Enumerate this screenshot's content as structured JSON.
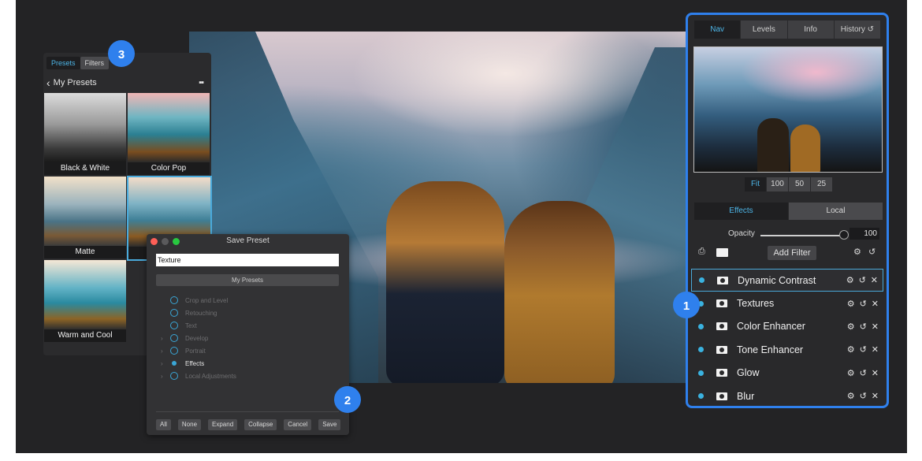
{
  "presets_panel": {
    "tabs": [
      "Presets",
      "Filters"
    ],
    "header": "My Presets",
    "thumbnails": [
      {
        "caption": "Black & White",
        "selected": false
      },
      {
        "caption": "Color Pop",
        "selected": false
      },
      {
        "caption": "Matte",
        "selected": false
      },
      {
        "caption": "",
        "selected": true
      },
      {
        "caption": "Warm and Cool",
        "selected": false
      }
    ]
  },
  "save_dialog": {
    "title": "Save Preset",
    "name_value": "Texture",
    "folder": "My Presets",
    "categories": [
      {
        "label": "Crop and Level",
        "expandable": false,
        "selected": false
      },
      {
        "label": "Retouching",
        "expandable": false,
        "selected": false
      },
      {
        "label": "Text",
        "expandable": false,
        "selected": false
      },
      {
        "label": "Develop",
        "expandable": true,
        "selected": false
      },
      {
        "label": "Portrait",
        "expandable": true,
        "selected": false
      },
      {
        "label": "Effects",
        "expandable": true,
        "selected": true
      },
      {
        "label": "Local Adjustments",
        "expandable": true,
        "selected": false
      }
    ],
    "buttons": [
      "All",
      "None",
      "Expand",
      "Collapse",
      "Cancel",
      "Save"
    ]
  },
  "right_panel": {
    "tabs": [
      "Nav",
      "Levels",
      "Info",
      "History"
    ],
    "active_tab": "Nav",
    "zoom_options": [
      "Fit",
      "100",
      "50",
      "25"
    ],
    "active_zoom": "Fit",
    "mode_tabs": [
      "Effects",
      "Local"
    ],
    "active_mode": "Effects",
    "opacity_label": "Opacity",
    "opacity_value": "100",
    "add_filter_label": "Add Filter",
    "filters": [
      {
        "name": "Dynamic Contrast",
        "selected": true
      },
      {
        "name": "Textures",
        "selected": false
      },
      {
        "name": "Color Enhancer",
        "selected": false
      },
      {
        "name": "Tone Enhancer",
        "selected": false
      },
      {
        "name": "Glow",
        "selected": false
      },
      {
        "name": "Blur",
        "selected": false
      }
    ]
  },
  "badges": [
    "1",
    "2",
    "3"
  ],
  "colors": {
    "accent_blue": "#2f80ed",
    "active_tab_text": "#4db6e8",
    "filter_dot": "#3ab2e0",
    "traffic_red": "#fe5f57",
    "traffic_yellow": "#5a5a5c",
    "traffic_green": "#28c840"
  },
  "icons": [
    "back-chevron-icon",
    "grid-view-icon",
    "history-undo-icon",
    "export-icon",
    "mask-icon",
    "gear-icon",
    "reset-icon",
    "close-icon"
  ]
}
